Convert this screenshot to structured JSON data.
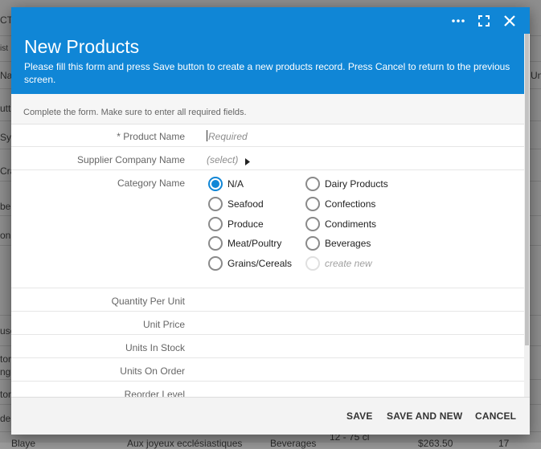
{
  "background": {
    "fragments": [
      "CTS",
      "ist",
      "Na",
      "utt",
      "Sy",
      "Cra",
      "ber",
      "on",
      "use",
      "ton",
      "ng'",
      "ton",
      "de",
      "Un",
      "Blaye",
      "Aux joyeux ecclésiastiques",
      "Beverages",
      "12 - 75 cl",
      "$263.50",
      "17"
    ]
  },
  "modal": {
    "title": "New Products",
    "description": "Please fill this form and press Save button to create a new products record. Press Cancel to return to the previous screen.",
    "hint": "Complete the form. Make sure to enter all required fields.",
    "fields": {
      "product_name": {
        "label": "* Product Name",
        "placeholder": "Required"
      },
      "supplier": {
        "label": "Supplier Company Name",
        "value": "(select)"
      },
      "category": {
        "label": "Category Name",
        "options": [
          "N/A",
          "Seafood",
          "Produce",
          "Meat/Poultry",
          "Grains/Cereals",
          "Dairy Products",
          "Confections",
          "Condiments",
          "Beverages",
          "create new"
        ],
        "selected": "N/A"
      },
      "quantity_per_unit": {
        "label": "Quantity Per Unit"
      },
      "unit_price": {
        "label": "Unit Price"
      },
      "units_in_stock": {
        "label": "Units In Stock"
      },
      "units_on_order": {
        "label": "Units On Order"
      },
      "reorder_level": {
        "label": "Reorder Level"
      }
    },
    "buttons": {
      "save": "SAVE",
      "save_and_new": "SAVE AND NEW",
      "cancel": "CANCEL"
    },
    "icons": [
      "more-icon",
      "maximize-icon",
      "close-icon",
      "dropdown-arrow-icon"
    ]
  },
  "colors": {
    "accent": "#1086d6",
    "header_text": "#ffffff"
  }
}
